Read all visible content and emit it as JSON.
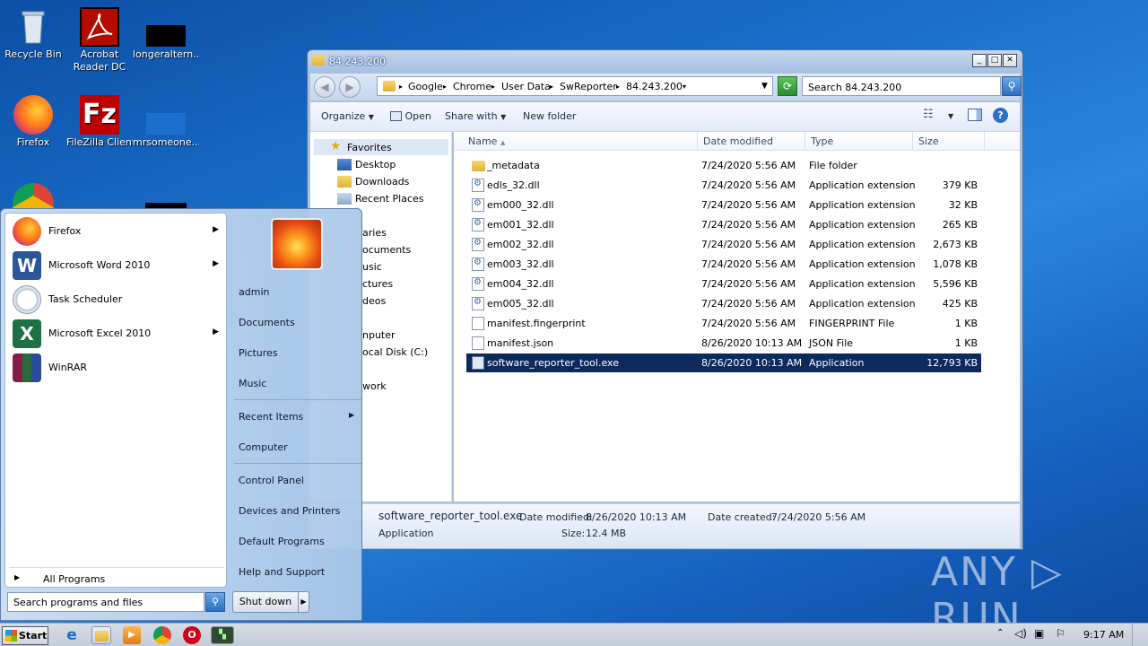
{
  "desktop": {
    "icons": [
      {
        "label": "Recycle Bin"
      },
      {
        "label": "Acrobat Reader DC"
      },
      {
        "label": "longeraltern..."
      },
      {
        "label": "Firefox"
      },
      {
        "label": "FileZilla Client"
      },
      {
        "label": "mrsomeone...."
      }
    ]
  },
  "explorer": {
    "title": "84.243.200",
    "caption": {
      "minimize": "_",
      "maximize": "□",
      "close": "✕"
    },
    "breadcrumb": [
      "Google",
      "Chrome",
      "User Data",
      "SwReporter",
      "84.243.200"
    ],
    "search_placeholder": "Search 84.243.200",
    "toolbar": {
      "organize": "Organize",
      "open": "Open",
      "share_with": "Share with",
      "new_folder": "New folder"
    },
    "nav": {
      "favorites": "Favorites",
      "items": [
        "Desktop",
        "Downloads",
        "Recent Places"
      ],
      "partial": [
        "aries",
        "ocuments",
        "usic",
        "ctures",
        "deos",
        "nputer",
        "ocal Disk (C:)",
        "work"
      ]
    },
    "columns": {
      "name": "Name",
      "date": "Date modified",
      "type": "Type",
      "size": "Size"
    },
    "files": [
      {
        "name": "_metadata",
        "date": "7/24/2020 5:56 AM",
        "type": "File folder",
        "size": "",
        "kind": "folder"
      },
      {
        "name": "edls_32.dll",
        "date": "7/24/2020 5:56 AM",
        "type": "Application extension",
        "size": "379 KB",
        "kind": "dll"
      },
      {
        "name": "em000_32.dll",
        "date": "7/24/2020 5:56 AM",
        "type": "Application extension",
        "size": "32 KB",
        "kind": "dll"
      },
      {
        "name": "em001_32.dll",
        "date": "7/24/2020 5:56 AM",
        "type": "Application extension",
        "size": "265 KB",
        "kind": "dll"
      },
      {
        "name": "em002_32.dll",
        "date": "7/24/2020 5:56 AM",
        "type": "Application extension",
        "size": "2,673 KB",
        "kind": "dll"
      },
      {
        "name": "em003_32.dll",
        "date": "7/24/2020 5:56 AM",
        "type": "Application extension",
        "size": "1,078 KB",
        "kind": "dll"
      },
      {
        "name": "em004_32.dll",
        "date": "7/24/2020 5:56 AM",
        "type": "Application extension",
        "size": "5,596 KB",
        "kind": "dll"
      },
      {
        "name": "em005_32.dll",
        "date": "7/24/2020 5:56 AM",
        "type": "Application extension",
        "size": "425 KB",
        "kind": "dll"
      },
      {
        "name": "manifest.fingerprint",
        "date": "7/24/2020 5:56 AM",
        "type": "FINGERPRINT File",
        "size": "1 KB",
        "kind": "file"
      },
      {
        "name": "manifest.json",
        "date": "8/26/2020 10:13 AM",
        "type": "JSON File",
        "size": "1 KB",
        "kind": "file"
      },
      {
        "name": "software_reporter_tool.exe",
        "date": "8/26/2020 10:13 AM",
        "type": "Application",
        "size": "12,793 KB",
        "kind": "exe",
        "selected": true
      }
    ],
    "details": {
      "filename": "software_reporter_tool.exe",
      "type": "Application",
      "modified_label": "Date modified:",
      "modified": "8/26/2020 10:13 AM",
      "created_label": "Date created:",
      "created": "7/24/2020 5:56 AM",
      "size_label": "Size:",
      "size": "12.4 MB"
    }
  },
  "start_menu": {
    "programs": [
      {
        "label": "Firefox",
        "arrow": true
      },
      {
        "label": "Microsoft Word 2010",
        "arrow": true
      },
      {
        "label": "Task Scheduler",
        "arrow": false
      },
      {
        "label": "Microsoft Excel 2010",
        "arrow": true
      },
      {
        "label": "WinRAR",
        "arrow": false
      }
    ],
    "all_programs": "All Programs",
    "search_placeholder": "Search programs and files",
    "right": {
      "user": "admin",
      "documents": "Documents",
      "pictures": "Pictures",
      "music": "Music",
      "recent_items": "Recent Items",
      "computer": "Computer",
      "control_panel": "Control Panel",
      "devices_printers": "Devices and Printers",
      "default_programs": "Default Programs",
      "help_support": "Help and Support"
    },
    "shutdown": "Shut down"
  },
  "taskbar": {
    "start": "Start",
    "clock": "9:17 AM"
  },
  "watermark": "ANY ▷ RUN"
}
